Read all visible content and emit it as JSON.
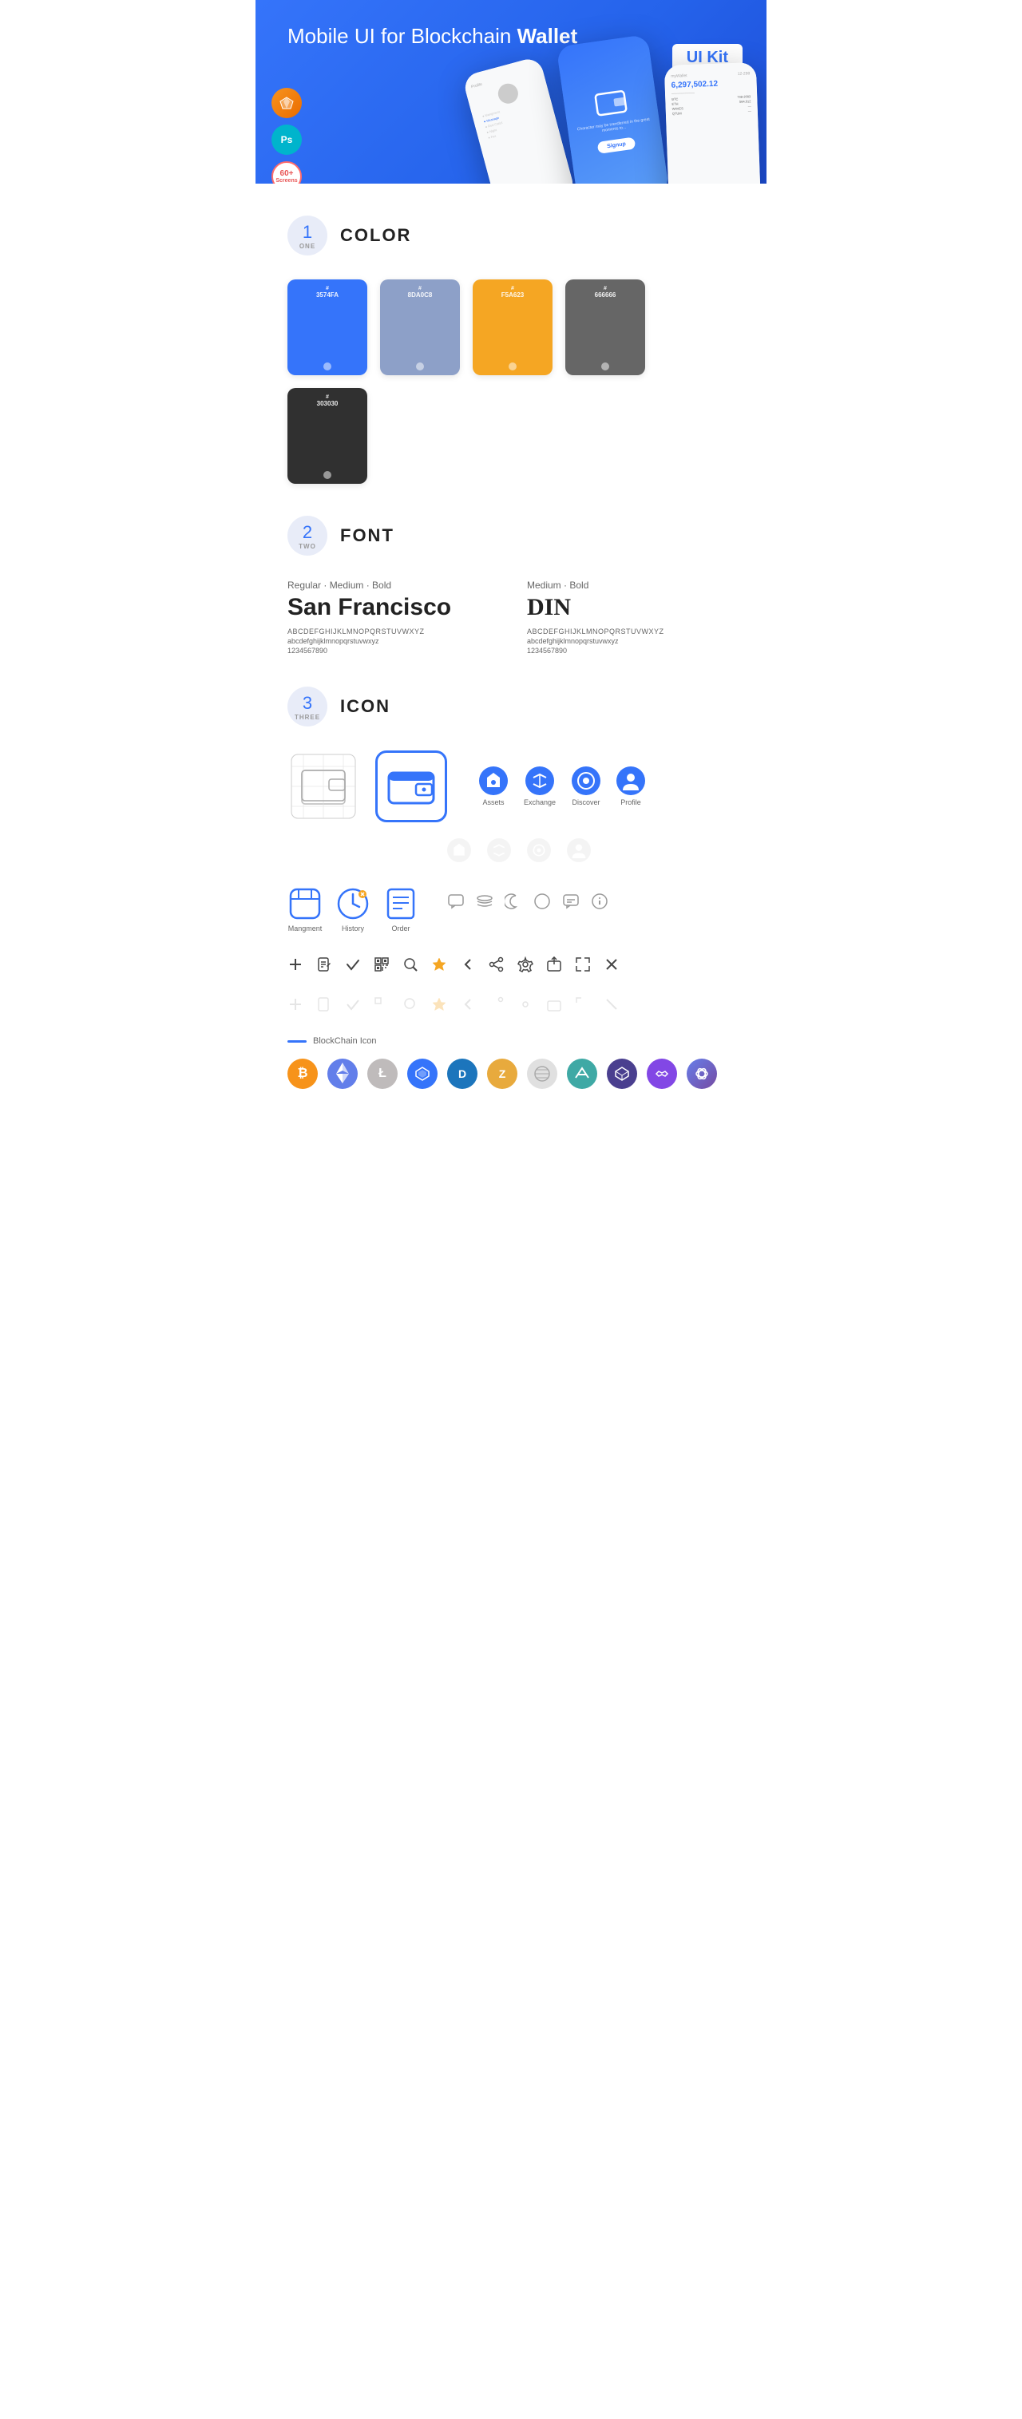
{
  "hero": {
    "title_normal": "Mobile UI for Blockchain ",
    "title_bold": "Wallet",
    "badge": "UI Kit",
    "badges": [
      {
        "label": "S",
        "type": "sketch"
      },
      {
        "label": "Ps",
        "type": "ps"
      },
      {
        "label": "60+\nScreens",
        "type": "count"
      }
    ]
  },
  "sections": {
    "color": {
      "number": "1",
      "word": "ONE",
      "title": "COLOR",
      "swatches": [
        {
          "hex": "#3574FA",
          "label": "3574FA",
          "dark": false
        },
        {
          "hex": "#8DA0C8",
          "label": "8DA0C8",
          "dark": false
        },
        {
          "hex": "#F5A623",
          "label": "F5A623",
          "dark": false
        },
        {
          "hex": "#666666",
          "label": "666666",
          "dark": false
        },
        {
          "hex": "#303030",
          "label": "303030",
          "dark": false
        }
      ]
    },
    "font": {
      "number": "2",
      "word": "TWO",
      "title": "FONT",
      "fonts": [
        {
          "style": "Regular · Medium · Bold",
          "name": "San Francisco",
          "alphabet": "ABCDEFGHIJKLMNOPQRSTUVWXYZ",
          "lowercase": "abcdefghijklmnopqrstuvwxyz",
          "numbers": "1234567890"
        },
        {
          "style": "Medium · Bold",
          "name": "DIN",
          "alphabet": "ABCDEFGHIJKLMNOPQRSTUVWXYZ",
          "lowercase": "abcdefghijklmnopqrstuvwxyz",
          "numbers": "1234567890"
        }
      ]
    },
    "icon": {
      "number": "3",
      "word": "THREE",
      "title": "ICON",
      "nav_icons": [
        {
          "label": "Assets"
        },
        {
          "label": "Exchange"
        },
        {
          "label": "Discover"
        },
        {
          "label": "Profile"
        }
      ],
      "app_icons": [
        {
          "label": "Mangment"
        },
        {
          "label": "History"
        },
        {
          "label": "Order"
        }
      ],
      "blockchain_label": "BlockChain Icon"
    }
  }
}
